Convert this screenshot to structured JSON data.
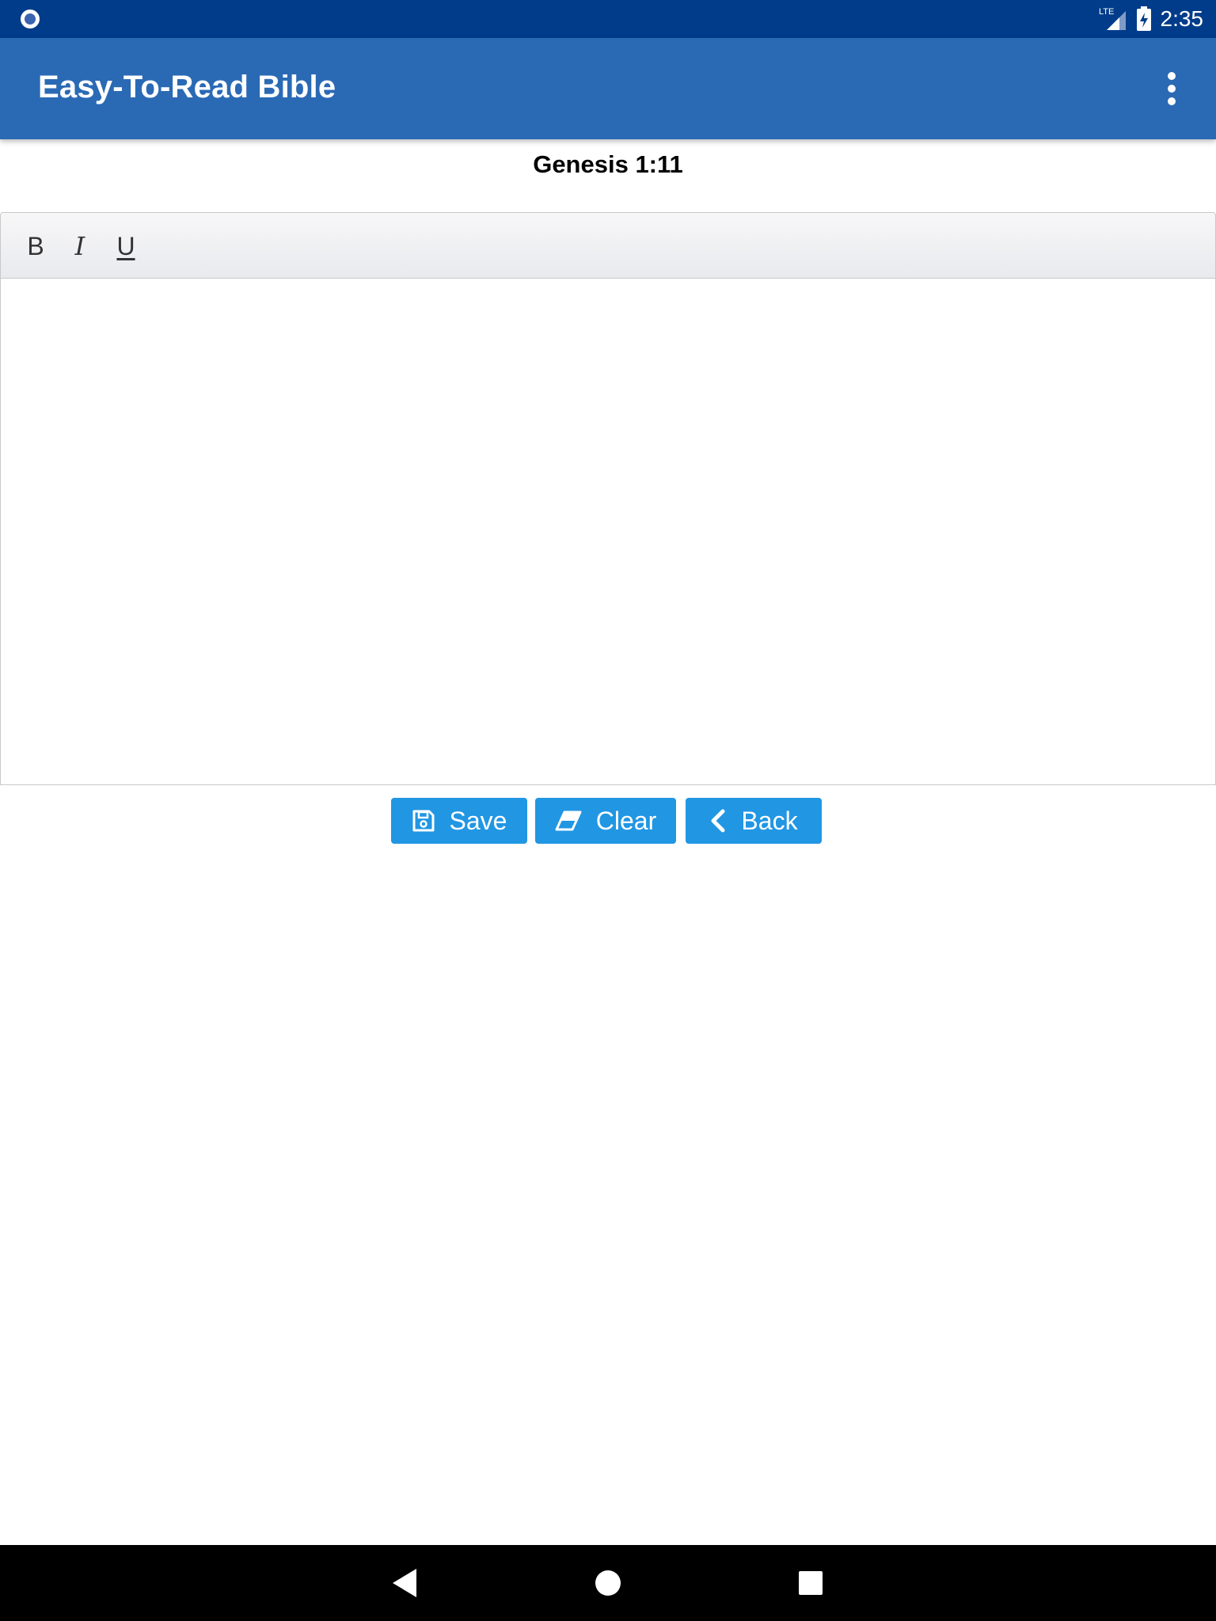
{
  "status_bar": {
    "network": "LTE",
    "time": "2:35"
  },
  "app_bar": {
    "title": "Easy-To-Read Bible",
    "menu_icon": "more-vert-icon"
  },
  "note": {
    "reference": "Genesis 1:11",
    "content": ""
  },
  "toolbar": {
    "bold_label": "B",
    "italic_label": "I",
    "underline_label": "U"
  },
  "actions": {
    "save_label": "Save",
    "clear_label": "Clear",
    "back_label": "Back"
  },
  "colors": {
    "status_bar": "#003c8a",
    "app_bar": "#2a6ab5",
    "button": "#2196e3"
  }
}
